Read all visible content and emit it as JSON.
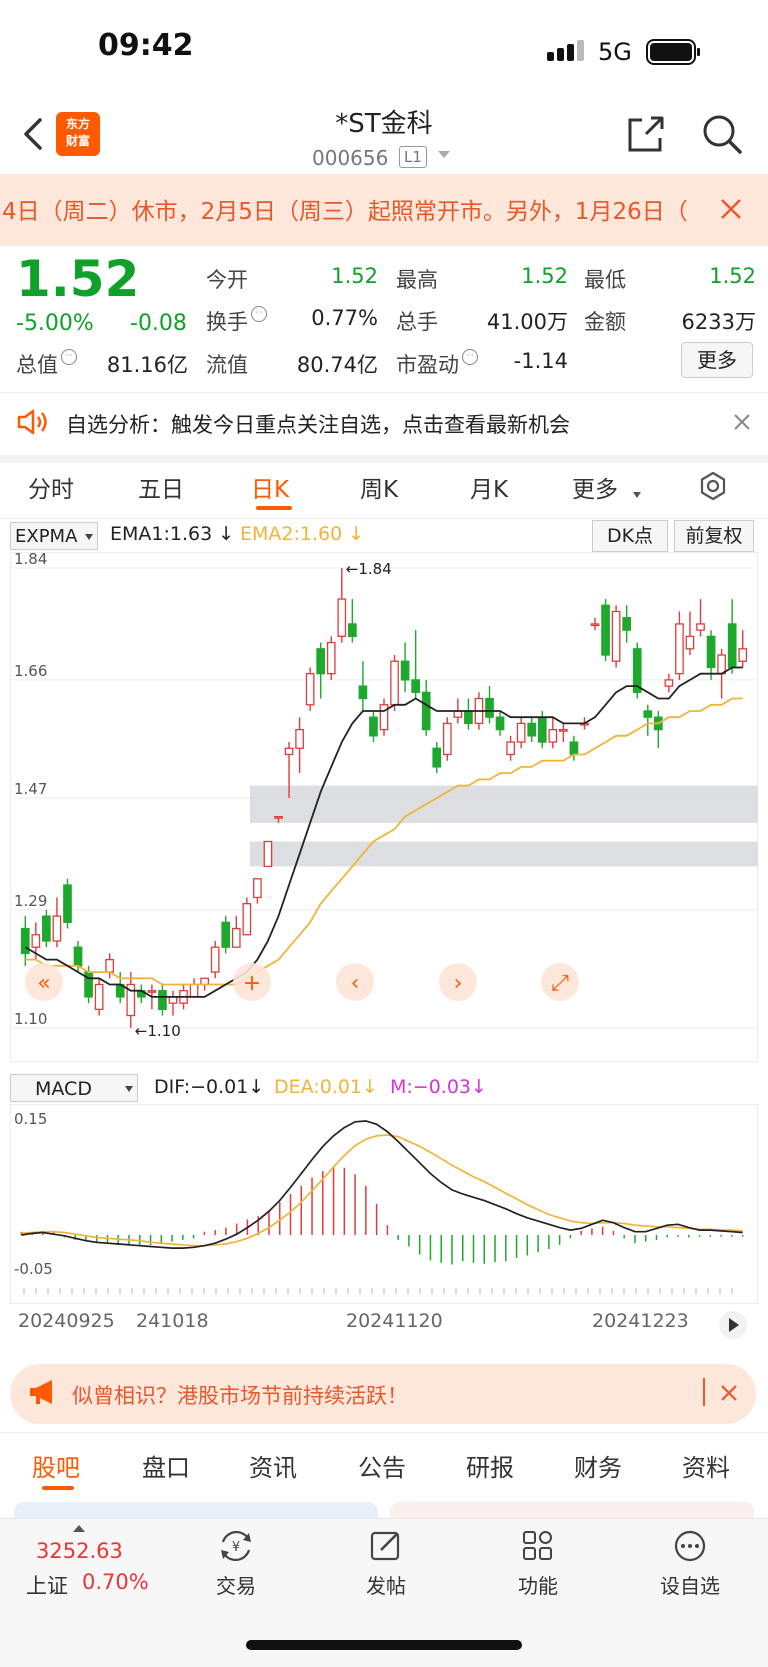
{
  "status_bar": {
    "time": "09:42",
    "network": "5G"
  },
  "header": {
    "title": "*ST金科",
    "code": "000656",
    "level": "L1",
    "logo_text": "东方\n财富"
  },
  "notice": {
    "text": "4日（周二）休市，2月5日（周三）起照常开市。另外，1月26日（"
  },
  "quote": {
    "price": "1.52",
    "change_pct": "-5.00%",
    "change": "-0.08",
    "rows": [
      [
        {
          "label": "今开",
          "value": "1.52",
          "green": true
        },
        {
          "label": "最高",
          "value": "1.52",
          "green": true
        },
        {
          "label": "最低",
          "value": "1.52",
          "green": true
        }
      ],
      [
        {
          "label": "换手",
          "value": "0.77%",
          "info": true
        },
        {
          "label": "总手",
          "value": "41.00万"
        },
        {
          "label": "金额",
          "value": "6233万"
        }
      ],
      [
        {
          "label": "总值",
          "value": "81.16亿",
          "info": true
        },
        {
          "label": "流值",
          "value": "80.74亿"
        },
        {
          "label": "市盈动",
          "value": "-1.14",
          "info": true
        }
      ]
    ],
    "more_label": "更多"
  },
  "hint": {
    "text": "自选分析：触发今日重点关注自选，点击查看最新机会"
  },
  "period_tabs": [
    "分时",
    "五日",
    "日K",
    "周K",
    "月K",
    "更多"
  ],
  "active_period": "日K",
  "indicator": {
    "name": "EXPMA",
    "ema1": "EMA1:1.63",
    "ema2": "EMA2:1.60",
    "dk_label": "DK点",
    "adjust_label": "前复权"
  },
  "chart_data": [
    {
      "type": "candlestick",
      "title": "",
      "ylim": [
        1.1,
        1.84
      ],
      "y_ticks": [
        "1.84",
        "1.66",
        "1.47",
        "1.29",
        "1.10"
      ],
      "max_label": "←1.84",
      "min_label": "←1.10",
      "up_color": "#e23b3b",
      "down_color": "#1ea82e",
      "candles": [
        {
          "o": 1.26,
          "c": 1.22,
          "h": 1.28,
          "l": 1.2
        },
        {
          "o": 1.23,
          "c": 1.25,
          "h": 1.27,
          "l": 1.21
        },
        {
          "o": 1.28,
          "c": 1.24,
          "h": 1.29,
          "l": 1.23
        },
        {
          "o": 1.24,
          "c": 1.28,
          "h": 1.31,
          "l": 1.23
        },
        {
          "o": 1.33,
          "c": 1.27,
          "h": 1.34,
          "l": 1.26
        },
        {
          "o": 1.23,
          "c": 1.2,
          "h": 1.24,
          "l": 1.19
        },
        {
          "o": 1.19,
          "c": 1.15,
          "h": 1.2,
          "l": 1.14
        },
        {
          "o": 1.13,
          "c": 1.17,
          "h": 1.18,
          "l": 1.12
        },
        {
          "o": 1.19,
          "c": 1.21,
          "h": 1.22,
          "l": 1.18
        },
        {
          "o": 1.17,
          "c": 1.15,
          "h": 1.19,
          "l": 1.14
        },
        {
          "o": 1.12,
          "c": 1.17,
          "h": 1.19,
          "l": 1.1
        },
        {
          "o": 1.16,
          "c": 1.15,
          "h": 1.17,
          "l": 1.14
        },
        {
          "o": 1.16,
          "c": 1.16,
          "h": 1.17,
          "l": 1.13
        },
        {
          "o": 1.16,
          "c": 1.13,
          "h": 1.17,
          "l": 1.12
        },
        {
          "o": 1.14,
          "c": 1.15,
          "h": 1.16,
          "l": 1.12
        },
        {
          "o": 1.14,
          "c": 1.16,
          "h": 1.17,
          "l": 1.13
        },
        {
          "o": 1.15,
          "c": 1.17,
          "h": 1.18,
          "l": 1.15
        },
        {
          "o": 1.17,
          "c": 1.18,
          "h": 1.18,
          "l": 1.16
        },
        {
          "o": 1.19,
          "c": 1.23,
          "h": 1.24,
          "l": 1.18
        },
        {
          "o": 1.27,
          "c": 1.23,
          "h": 1.28,
          "l": 1.22
        },
        {
          "o": 1.23,
          "c": 1.26,
          "h": 1.28,
          "l": 1.23
        },
        {
          "o": 1.25,
          "c": 1.3,
          "h": 1.31,
          "l": 1.25
        },
        {
          "o": 1.31,
          "c": 1.34,
          "h": 1.34,
          "l": 1.3
        },
        {
          "o": 1.36,
          "c": 1.4,
          "h": 1.4,
          "l": 1.36
        },
        {
          "o": 1.44,
          "c": 1.44,
          "h": 1.44,
          "l": 1.43
        },
        {
          "o": 1.54,
          "c": 1.55,
          "h": 1.56,
          "l": 1.47
        },
        {
          "o": 1.55,
          "c": 1.58,
          "h": 1.6,
          "l": 1.51
        },
        {
          "o": 1.62,
          "c": 1.67,
          "h": 1.68,
          "l": 1.61
        },
        {
          "o": 1.71,
          "c": 1.67,
          "h": 1.72,
          "l": 1.63
        },
        {
          "o": 1.67,
          "c": 1.72,
          "h": 1.73,
          "l": 1.66
        },
        {
          "o": 1.73,
          "c": 1.79,
          "h": 1.84,
          "l": 1.72
        },
        {
          "o": 1.75,
          "c": 1.73,
          "h": 1.79,
          "l": 1.72
        },
        {
          "o": 1.65,
          "c": 1.63,
          "h": 1.69,
          "l": 1.61
        },
        {
          "o": 1.6,
          "c": 1.57,
          "h": 1.61,
          "l": 1.56
        },
        {
          "o": 1.58,
          "c": 1.62,
          "h": 1.63,
          "l": 1.57
        },
        {
          "o": 1.62,
          "c": 1.69,
          "h": 1.7,
          "l": 1.61
        },
        {
          "o": 1.69,
          "c": 1.66,
          "h": 1.72,
          "l": 1.64
        },
        {
          "o": 1.66,
          "c": 1.64,
          "h": 1.74,
          "l": 1.63
        },
        {
          "o": 1.64,
          "c": 1.58,
          "h": 1.66,
          "l": 1.57
        },
        {
          "o": 1.55,
          "c": 1.52,
          "h": 1.56,
          "l": 1.51
        },
        {
          "o": 1.54,
          "c": 1.59,
          "h": 1.6,
          "l": 1.53
        },
        {
          "o": 1.6,
          "c": 1.61,
          "h": 1.63,
          "l": 1.59
        },
        {
          "o": 1.61,
          "c": 1.59,
          "h": 1.63,
          "l": 1.58
        },
        {
          "o": 1.59,
          "c": 1.63,
          "h": 1.64,
          "l": 1.58
        },
        {
          "o": 1.63,
          "c": 1.6,
          "h": 1.65,
          "l": 1.59
        },
        {
          "o": 1.6,
          "c": 1.58,
          "h": 1.61,
          "l": 1.57
        },
        {
          "o": 1.54,
          "c": 1.56,
          "h": 1.57,
          "l": 1.53
        },
        {
          "o": 1.56,
          "c": 1.59,
          "h": 1.6,
          "l": 1.55
        },
        {
          "o": 1.59,
          "c": 1.57,
          "h": 1.6,
          "l": 1.56
        },
        {
          "o": 1.6,
          "c": 1.56,
          "h": 1.61,
          "l": 1.55
        },
        {
          "o": 1.56,
          "c": 1.58,
          "h": 1.6,
          "l": 1.55
        },
        {
          "o": 1.58,
          "c": 1.58,
          "h": 1.59,
          "l": 1.56
        },
        {
          "o": 1.56,
          "c": 1.54,
          "h": 1.57,
          "l": 1.53
        },
        {
          "o": 1.59,
          "c": 1.59,
          "h": 1.6,
          "l": 1.58
        },
        {
          "o": 1.75,
          "c": 1.75,
          "h": 1.76,
          "l": 1.74
        },
        {
          "o": 1.78,
          "c": 1.7,
          "h": 1.79,
          "l": 1.69
        },
        {
          "o": 1.69,
          "c": 1.77,
          "h": 1.78,
          "l": 1.68
        },
        {
          "o": 1.76,
          "c": 1.74,
          "h": 1.78,
          "l": 1.72
        },
        {
          "o": 1.71,
          "c": 1.64,
          "h": 1.72,
          "l": 1.63
        },
        {
          "o": 1.61,
          "c": 1.6,
          "h": 1.62,
          "l": 1.57
        },
        {
          "o": 1.6,
          "c": 1.58,
          "h": 1.61,
          "l": 1.55
        },
        {
          "o": 1.65,
          "c": 1.66,
          "h": 1.67,
          "l": 1.64
        },
        {
          "o": 1.67,
          "c": 1.75,
          "h": 1.77,
          "l": 1.66
        },
        {
          "o": 1.71,
          "c": 1.73,
          "h": 1.77,
          "l": 1.7
        },
        {
          "o": 1.74,
          "c": 1.75,
          "h": 1.79,
          "l": 1.73
        },
        {
          "o": 1.73,
          "c": 1.68,
          "h": 1.74,
          "l": 1.66
        },
        {
          "o": 1.67,
          "c": 1.7,
          "h": 1.71,
          "l": 1.63
        },
        {
          "o": 1.75,
          "c": 1.68,
          "h": 1.79,
          "l": 1.67
        },
        {
          "o": 1.69,
          "c": 1.71,
          "h": 1.74,
          "l": 1.68
        }
      ],
      "ema1": [
        1.23,
        1.22,
        1.21,
        1.21,
        1.2,
        1.19,
        1.18,
        1.18,
        1.17,
        1.17,
        1.16,
        1.16,
        1.15,
        1.15,
        1.15,
        1.15,
        1.15,
        1.15,
        1.16,
        1.17,
        1.18,
        1.19,
        1.21,
        1.24,
        1.28,
        1.33,
        1.38,
        1.43,
        1.48,
        1.52,
        1.56,
        1.59,
        1.61,
        1.61,
        1.61,
        1.62,
        1.62,
        1.63,
        1.62,
        1.61,
        1.61,
        1.61,
        1.61,
        1.61,
        1.61,
        1.61,
        1.6,
        1.6,
        1.6,
        1.6,
        1.6,
        1.59,
        1.59,
        1.59,
        1.6,
        1.62,
        1.64,
        1.65,
        1.65,
        1.64,
        1.63,
        1.63,
        1.65,
        1.66,
        1.67,
        1.67,
        1.67,
        1.68,
        1.68
      ],
      "ema2": [
        1.21,
        1.21,
        1.2,
        1.2,
        1.2,
        1.2,
        1.19,
        1.19,
        1.19,
        1.18,
        1.18,
        1.18,
        1.18,
        1.17,
        1.17,
        1.17,
        1.17,
        1.17,
        1.17,
        1.17,
        1.17,
        1.18,
        1.19,
        1.2,
        1.21,
        1.23,
        1.25,
        1.27,
        1.3,
        1.32,
        1.34,
        1.36,
        1.38,
        1.4,
        1.41,
        1.42,
        1.44,
        1.45,
        1.46,
        1.47,
        1.48,
        1.49,
        1.49,
        1.5,
        1.5,
        1.51,
        1.51,
        1.52,
        1.52,
        1.53,
        1.53,
        1.53,
        1.54,
        1.54,
        1.55,
        1.56,
        1.57,
        1.57,
        1.58,
        1.59,
        1.59,
        1.6,
        1.6,
        1.61,
        1.61,
        1.62,
        1.62,
        1.63,
        1.63
      ],
      "zones": [
        [
          1.43,
          1.49
        ],
        [
          1.36,
          1.4
        ]
      ]
    },
    {
      "type": "macd",
      "title": "",
      "ylim": [
        -0.05,
        0.15
      ],
      "y_ticks": [
        "0.15",
        "-0.05"
      ],
      "x_ticks": [
        "20240925",
        "241018",
        "20241120",
        "20241223"
      ],
      "dif": [
        0.0,
        0.002,
        0.003,
        0.001,
        -0.001,
        -0.004,
        -0.007,
        -0.009,
        -0.01,
        -0.011,
        -0.012,
        -0.013,
        -0.014,
        -0.015,
        -0.016,
        -0.016,
        -0.015,
        -0.013,
        -0.01,
        -0.005,
        0.001,
        0.009,
        0.018,
        0.029,
        0.042,
        0.058,
        0.075,
        0.092,
        0.108,
        0.121,
        0.131,
        0.138,
        0.139,
        0.135,
        0.126,
        0.114,
        0.101,
        0.088,
        0.075,
        0.064,
        0.055,
        0.05,
        0.046,
        0.042,
        0.037,
        0.032,
        0.026,
        0.021,
        0.017,
        0.013,
        0.009,
        0.006,
        0.008,
        0.013,
        0.018,
        0.015,
        0.009,
        0.004,
        0.004,
        0.008,
        0.012,
        0.013,
        0.009,
        0.006,
        0.006,
        0.005,
        0.004,
        0.003
      ],
      "dea": [
        0.002,
        0.003,
        0.004,
        0.004,
        0.003,
        0.001,
        -0.001,
        -0.003,
        -0.004,
        -0.005,
        -0.006,
        -0.007,
        -0.009,
        -0.01,
        -0.011,
        -0.012,
        -0.013,
        -0.013,
        -0.012,
        -0.011,
        -0.008,
        -0.004,
        0.002,
        0.009,
        0.018,
        0.028,
        0.04,
        0.054,
        0.068,
        0.083,
        0.097,
        0.109,
        0.117,
        0.121,
        0.122,
        0.12,
        0.114,
        0.108,
        0.101,
        0.093,
        0.085,
        0.078,
        0.071,
        0.065,
        0.058,
        0.051,
        0.044,
        0.037,
        0.031,
        0.025,
        0.021,
        0.017,
        0.015,
        0.014,
        0.015,
        0.015,
        0.014,
        0.012,
        0.011,
        0.01,
        0.01,
        0.009,
        0.008,
        0.007,
        0.007,
        0.006,
        0.006,
        0.005
      ],
      "hist": [
        0.004,
        0.004,
        0.003,
        0.004,
        -0.003,
        -0.006,
        -0.008,
        -0.009,
        -0.01,
        -0.011,
        -0.013,
        -0.014,
        -0.012,
        -0.01,
        -0.008,
        -0.006,
        -0.004,
        0.004,
        0.006,
        0.009,
        0.014,
        0.019,
        0.023,
        0.03,
        0.04,
        0.05,
        0.06,
        0.07,
        0.078,
        0.084,
        0.082,
        0.074,
        0.06,
        0.038,
        0.012,
        -0.006,
        -0.014,
        -0.024,
        -0.031,
        -0.034,
        -0.036,
        -0.032,
        -0.034,
        -0.035,
        -0.033,
        -0.032,
        -0.028,
        -0.025,
        -0.021,
        -0.017,
        -0.012,
        -0.004,
        0.005,
        0.008,
        0.01,
        0.005,
        -0.004,
        -0.01,
        -0.008,
        -0.006,
        -0.003,
        -0.002,
        -0.003,
        -0.002,
        -0.002,
        -0.002,
        -0.002,
        -0.002
      ],
      "dif_color": "#222222",
      "dea_color": "#f0b43a"
    }
  ],
  "macd_header": {
    "name": "MACD",
    "dif": "DIF:−0.01",
    "dea": "DEA:0.01",
    "m": "M:−0.03"
  },
  "promo": {
    "text": "似曾相识？港股市场节前持续活跃！"
  },
  "bottom_tabs": [
    "股吧",
    "盘口",
    "资讯",
    "公告",
    "研报",
    "财务",
    "资料"
  ],
  "active_bottom_tab": "股吧",
  "footer": {
    "index_value": "3252.63",
    "index_name": "上证",
    "index_pct": "0.70%",
    "buttons": [
      {
        "label": "交易",
        "icon": "trade-icon"
      },
      {
        "label": "发帖",
        "icon": "post-icon"
      },
      {
        "label": "功能",
        "icon": "function-icon"
      },
      {
        "label": "设自选",
        "icon": "add-watchlist-icon"
      }
    ]
  }
}
